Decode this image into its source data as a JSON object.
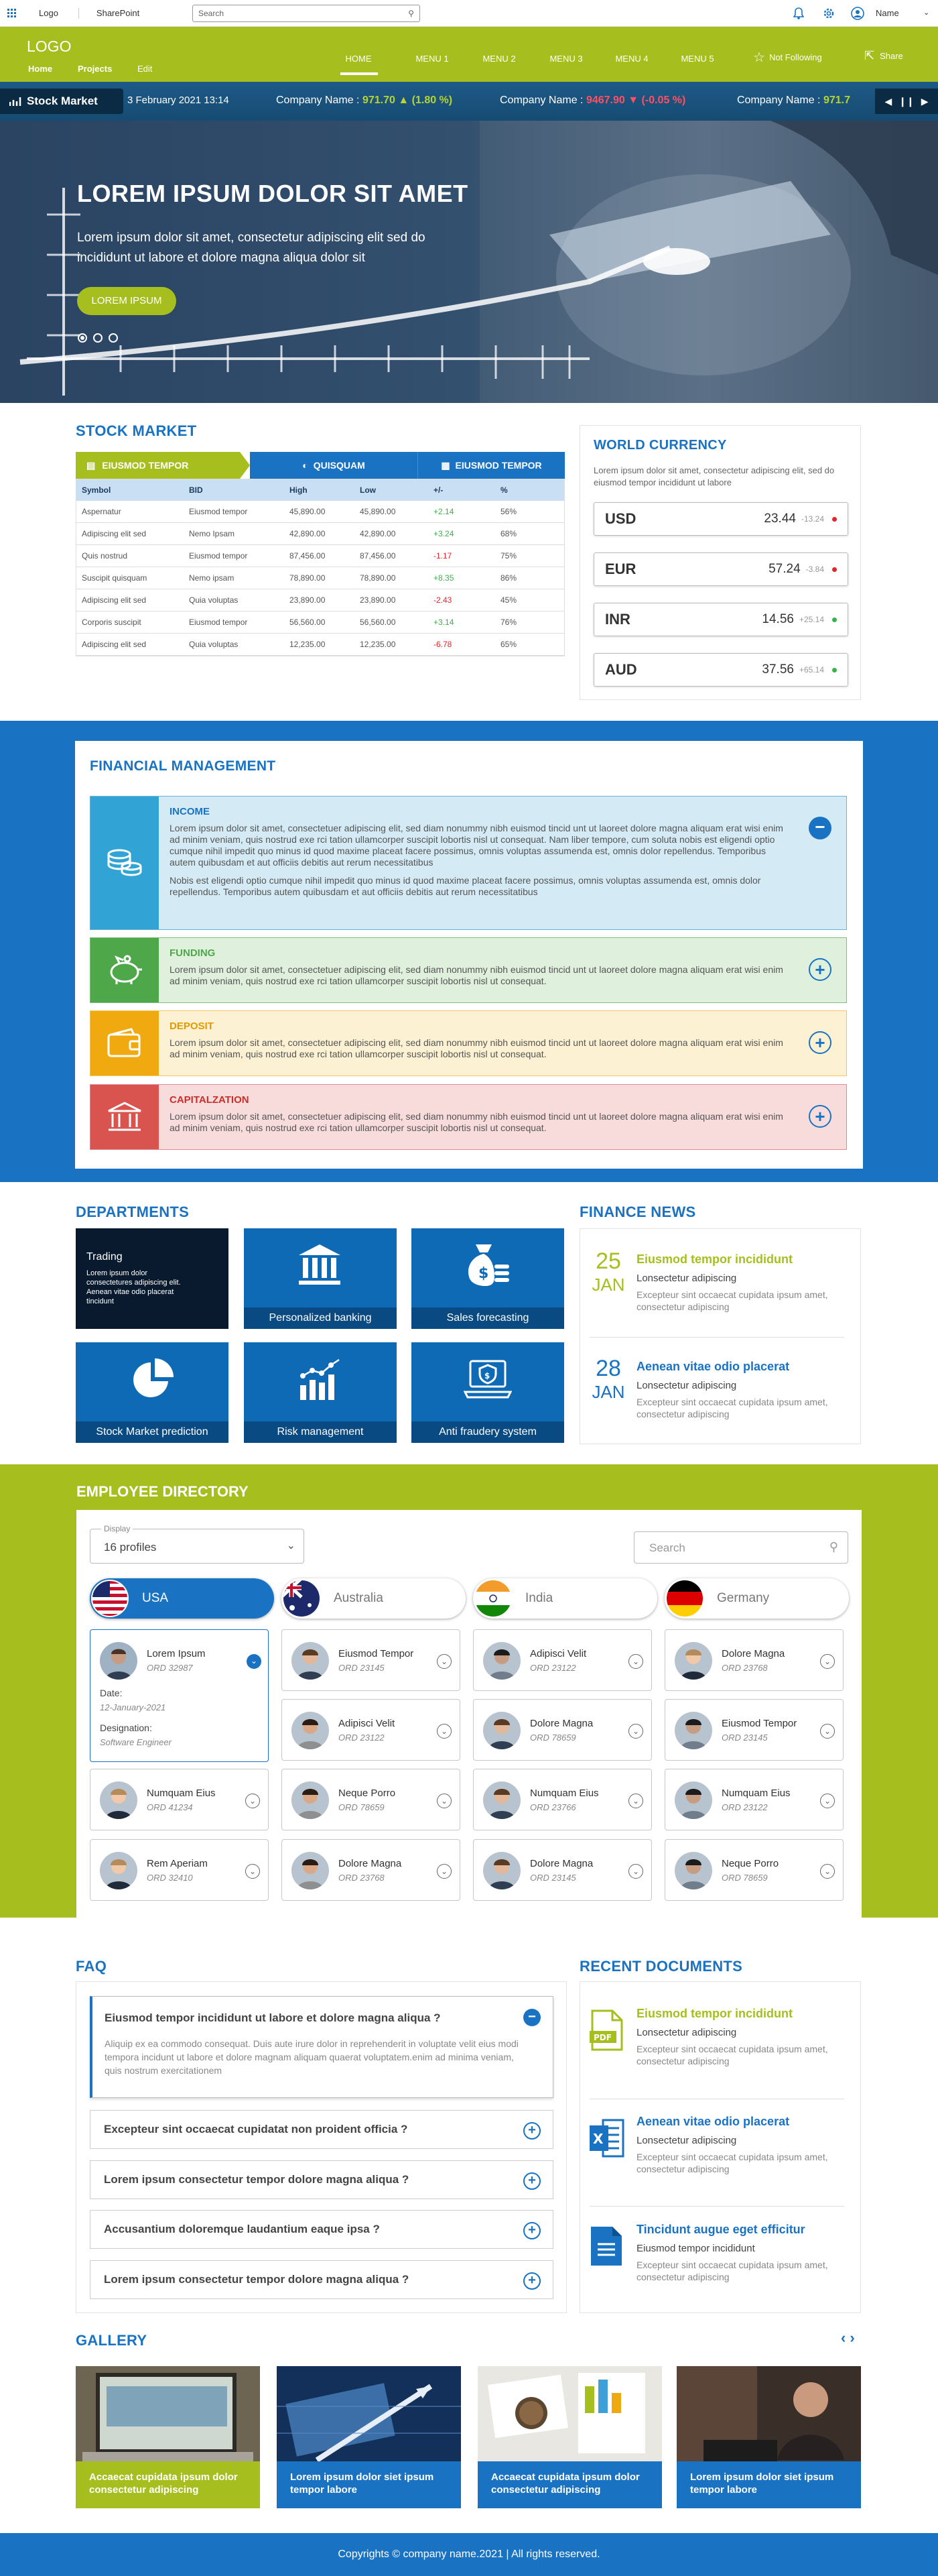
{
  "topbar": {
    "links": [
      "Logo",
      "SharePoint"
    ],
    "search_placeholder": "Search",
    "user": "Name"
  },
  "header": {
    "logo": "LOGO",
    "subnav": [
      "Home",
      "Projects",
      "Edit"
    ],
    "menu": [
      "HOME",
      "MENU 1",
      "MENU 2",
      "MENU 3",
      "MENU 4",
      "MENU 5"
    ],
    "not_following": "Not Following",
    "share": "Share"
  },
  "ticker": {
    "label": "Stock Market",
    "date": "3 February 2021 13:14",
    "items": [
      {
        "name": "Company Name :",
        "value": "971.70",
        "change": "(1.80 %)",
        "dir": "up"
      },
      {
        "name": "Company Name :",
        "value": "9467.90",
        "change": "(-0.05 %)",
        "dir": "down"
      },
      {
        "name": "Company Name :",
        "value": "971.7"
      }
    ]
  },
  "hero": {
    "title": "LOREM IPSUM DOLOR SIT AMET",
    "text": "Lorem ipsum dolor sit amet, consectetur adipiscing elit sed do incididunt ut labore et dolore magna aliqua dolor sit",
    "button": "LOREM IPSUM"
  },
  "stock": {
    "title": "STOCK MARKET",
    "tabs": [
      "EIUSMOD TEMPOR",
      "QUISQUAM",
      "EIUSMOD TEMPOR"
    ],
    "headers": [
      "Symbol",
      "BID",
      "High",
      "Low",
      "+/-",
      "%"
    ],
    "rows": [
      [
        "Aspernatur",
        "Eiusmod tempor",
        "45,890.00",
        "45,890.00",
        "+2.14",
        "56%"
      ],
      [
        "Adipiscing elit sed",
        "Nemo Ipsam",
        "42,890.00",
        "42,890.00",
        "+3.24",
        "68%"
      ],
      [
        "Quis nostrud",
        "Eiusmod tempor",
        "87,456.00",
        "87,456.00",
        "-1.17",
        "75%"
      ],
      [
        "Suscipit quisquam",
        "Nemo ipsam",
        "78,890.00",
        "78,890.00",
        "+8.35",
        "86%"
      ],
      [
        "Adipiscing elit sed",
        "Quia voluptas",
        "23,890.00",
        "23,890.00",
        "-2.43",
        "45%"
      ],
      [
        "Corporis suscipit",
        "Eiusmod tempor",
        "56,560.00",
        "56,560.00",
        "+3.14",
        "76%"
      ],
      [
        "Adipiscing elit sed",
        "Quia voluptas",
        "12,235.00",
        "12,235.00",
        "-6.78",
        "65%"
      ]
    ]
  },
  "currency": {
    "title": "WORLD CURRENCY",
    "text": "Lorem ipsum dolor sit amet, consectetur adipiscing elit, sed do eiusmod tempor incididunt ut labore",
    "items": [
      {
        "code": "USD",
        "value": "23.44",
        "change": "-13.24",
        "color": "#e0262b"
      },
      {
        "code": "EUR",
        "value": "57.24",
        "change": "-3.84",
        "color": "#e0262b"
      },
      {
        "code": "INR",
        "value": "14.56",
        "change": "+25.14",
        "color": "#37b34a"
      },
      {
        "code": "AUD",
        "value": "37.56",
        "change": "+65.14",
        "color": "#37b34a"
      }
    ]
  },
  "finance": {
    "title": "FINANCIAL MANAGEMENT",
    "items": [
      {
        "title": "INCOME",
        "text": "Lorem ipsum dolor sit amet, consectetuer adipiscing elit, sed diam nonummy nibh euismod tincid unt ut laoreet dolore magna aliquam erat wisi enim ad minim veniam, quis nostrud exe rci tation ullamcorper suscipit lobortis nisl ut consequat. Nam liber tempore, cum soluta nobis est eligendi optio cumque nihil impedit quo minus id quod maxime placeat facere possimus, omnis voluptas assumenda est, omnis dolor repellendus. Temporibus autem quibusdam et aut officiis debitis aut rerum necessitatibus",
        "text2": "Nobis est eligendi optio cumque nihil impedit quo minus id quod maxime placeat facere possimus, omnis voluptas assumenda est, omnis dolor repellendus. Temporibus autem quibusdam et aut officiis debitis aut rerum necessitatibus"
      },
      {
        "title": "FUNDING",
        "text": "Lorem ipsum dolor sit amet, consectetuer adipiscing elit, sed diam nonummy nibh euismod tincid unt ut laoreet dolore magna aliquam erat wisi enim ad minim veniam, quis nostrud exe rci tation ullamcorper suscipit lobortis nisl ut consequat."
      },
      {
        "title": "DEPOSIT",
        "text": "Lorem ipsum dolor sit amet, consectetuer adipiscing elit, sed diam nonummy nibh euismod tincid unt ut laoreet dolore magna aliquam erat wisi enim ad minim veniam, quis nostrud exe rci tation ullamcorper suscipit lobortis nisl ut consequat."
      },
      {
        "title": "CAPITALZATION",
        "text": "Lorem ipsum dolor sit amet, consectetuer adipiscing elit, sed diam nonummy nibh euismod tincid unt ut laoreet dolore magna aliquam erat wisi enim ad minim veniam, quis nostrud exe rci tation ullamcorper suscipit lobortis nisl ut consequat."
      }
    ]
  },
  "departments": {
    "title": "DEPARTMENTS",
    "trading_title": "Trading",
    "trading_text": "Lorem ipsum dolor consectetures adipiscing elit. Aenean vitae odio placerat tincidunt",
    "items": [
      "Personalized banking",
      "Sales forecasting",
      "Stock Market prediction",
      "Risk management",
      "Anti fraudery system"
    ]
  },
  "news": {
    "title": "FINANCE NEWS",
    "items": [
      {
        "day": "25",
        "month": "JAN",
        "title": "Eiusmod tempor incididunt",
        "sub": "Lonsectetur adipiscing",
        "text": "Excepteur sint occaecat cupidata  ipsum amet, consectetur adipiscing"
      },
      {
        "day": "28",
        "month": "JAN",
        "title": "Aenean vitae odio placerat",
        "sub": "Lonsectetur adipiscing",
        "text": "Excepteur sint occaecat cupidata  ipsum amet, consectetur adipiscing"
      }
    ]
  },
  "directory": {
    "title": "EMPLOYEE DIRECTORY",
    "display_label": "Display",
    "display_value": "16 profiles",
    "search_placeholder": "Search",
    "countries": [
      "USA",
      "Australia",
      "India",
      "Germany"
    ],
    "expanded": {
      "name": "Lorem Ipsum",
      "id": "ORD 32987",
      "date_label": "Date:",
      "date": "12-January-2021",
      "desig_label": "Designation:",
      "desig": "Software Engineer"
    },
    "people": [
      [
        "Eiusmod Tempor",
        "ORD 23145"
      ],
      [
        "Adipisci Velit",
        "ORD 23122"
      ],
      [
        "Dolore Magna",
        "ORD 23768"
      ],
      [
        "Adipisci Velit",
        "ORD 23122"
      ],
      [
        "Dolore Magna",
        "ORD 78659"
      ],
      [
        "Eiusmod Tempor",
        "ORD 23145"
      ],
      [
        "Numquam Eius",
        "ORD 41234"
      ],
      [
        "Neque Porro",
        "ORD 78659"
      ],
      [
        "Numquam Eius",
        "ORD 23766"
      ],
      [
        "Numquam Eius",
        "ORD 23122"
      ],
      [
        "Rem Aperiam",
        "ORD 32410"
      ],
      [
        "Dolore Magna",
        "ORD 23768"
      ],
      [
        "Dolore Magna",
        "ORD 23145"
      ],
      [
        "Neque Porro",
        "ORD 78659"
      ]
    ]
  },
  "faq": {
    "title": "FAQ",
    "open_q": "Eiusmod tempor incididunt ut labore et dolore magna aliqua ?",
    "open_a": "Aliquip ex ea commodo consequat. Duis aute irure dolor in reprehenderit in voluptate velit eius modi tempora incidunt ut labore et dolore magnam aliquam quaerat voluptatem.enim ad minima veniam, quis nostrum exercitationem",
    "questions": [
      "Excepteur sint occaecat cupidatat non proident officia ?",
      "Lorem ipsum consectetur  tempor dolore magna aliqua ?",
      "Accusantium doloremque laudantium eaque ipsa ?",
      "Lorem ipsum consectetur  tempor dolore magna aliqua ?"
    ]
  },
  "docs": {
    "title": "RECENT DOCUMENTS",
    "items": [
      {
        "title": "Eiusmod tempor incididunt",
        "sub": "Lonsectetur adipiscing",
        "text": "Excepteur sint occaecat cupidata  ipsum amet, consectetur adipiscing",
        "color": "#a6bf1e",
        "icon": "pdf"
      },
      {
        "title": "Aenean vitae odio placerat",
        "sub": "Lonsectetur adipiscing",
        "text": "Excepteur sint occaecat cupidata  ipsum amet, consectetur adipiscing",
        "color": "#1a73c2",
        "icon": "excel"
      },
      {
        "title": "Tincidunt augue eget efficitur",
        "sub": "Eiusmod tempor incididunt",
        "text": "Excepteur sint occaecat cupidata  ipsum amet, consectetur adipiscing",
        "color": "#1a73c2",
        "icon": "doc"
      }
    ]
  },
  "gallery": {
    "title": "GALLERY",
    "items": [
      "Accaecat cupidata  ipsum dolor consectetur adipiscing",
      "Lorem ipsum dolor siet  ipsum tempor labore",
      "Accaecat cupidata  ipsum dolor consectetur adipiscing",
      "Lorem ipsum dolor siet  ipsum tempor labore"
    ]
  },
  "footer": {
    "text": "Copyrights © company name.2021 | All rights reserved."
  },
  "colors": {
    "green": "#a6bf1e",
    "blue": "#1a73c2",
    "dark_blue": "#094a82"
  }
}
